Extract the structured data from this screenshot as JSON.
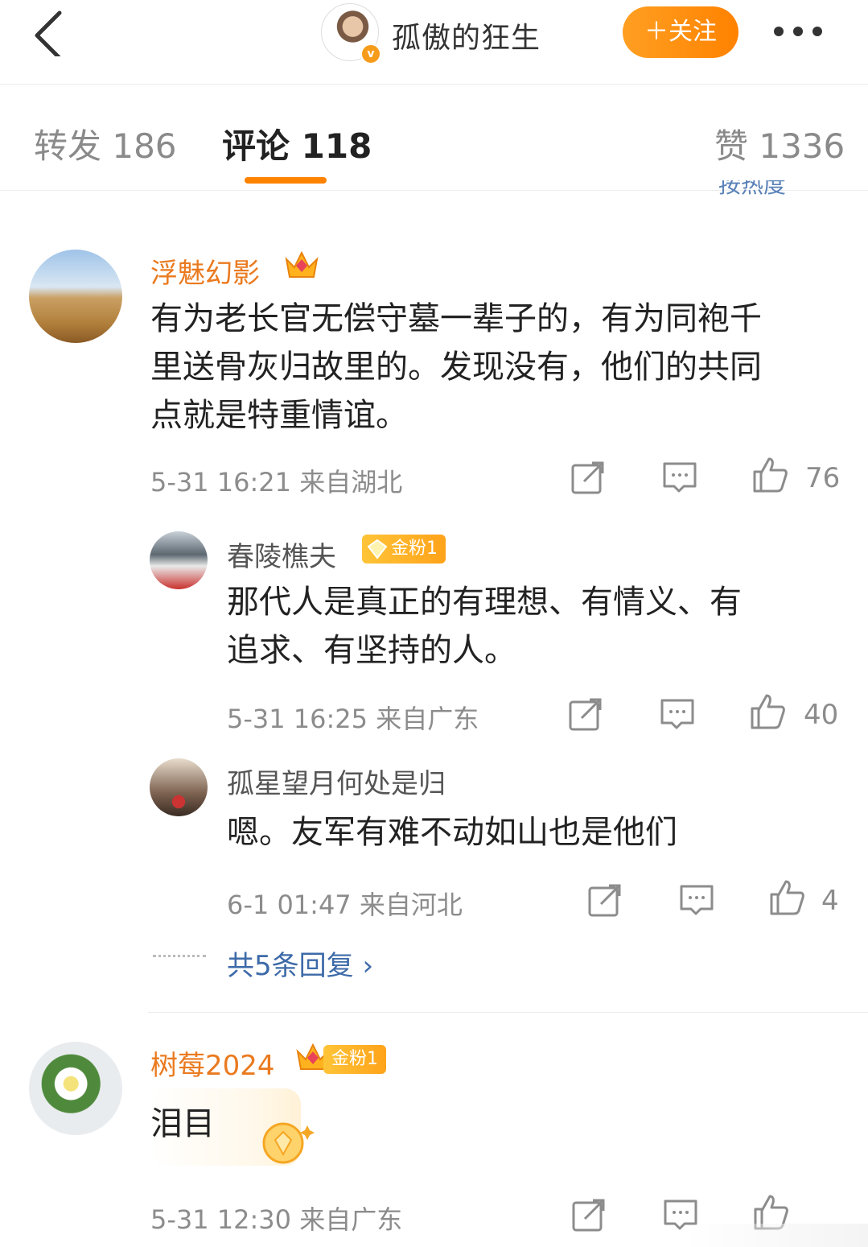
{
  "header": {
    "back_icon": "chevron-left-icon",
    "user_name": "孤傲的狂生",
    "verified_badge": "v",
    "follow_label": "＋关注",
    "more_icon": "more-dots-icon"
  },
  "tabs": [
    {
      "label": "转发 186"
    },
    {
      "label": "评论 118"
    },
    {
      "label": "赞 1336"
    }
  ],
  "sort_label": "按热度",
  "comments": [
    {
      "user": "浮魅幻影",
      "text_lines": [
        "有为老长官无偿守墓一辈子的，有为同袍千",
        "里送骨灰归故里的。发现没有，他们的共同",
        "点就是特重情谊。"
      ],
      "meta": "5-31 16:21  来自湖北",
      "likes": "76"
    },
    {
      "user": "春陵樵夫",
      "badge": "金粉1",
      "text_lines": [
        "那代人是真正的有理想、有情义、有",
        "追求、有坚持的人。"
      ],
      "meta": "5-31 16:25  来自广东",
      "likes": "40"
    },
    {
      "user": "孤星望月何处是归",
      "text_lines": [
        "嗯。友军有难不动如山也是他们"
      ],
      "meta": "6-1 01:47  来自河北",
      "likes": "4"
    },
    {
      "user": "树莓2024",
      "badge": "金粉1",
      "text_lines": [
        "泪目"
      ],
      "meta": "5-31 12:30  来自广东",
      "likes": ""
    }
  ],
  "more_replies": "共5条回复 ›",
  "colors": {
    "accent": "#ff8200",
    "link": "#3d6aa8",
    "vip_name": "#ea7a1f"
  }
}
